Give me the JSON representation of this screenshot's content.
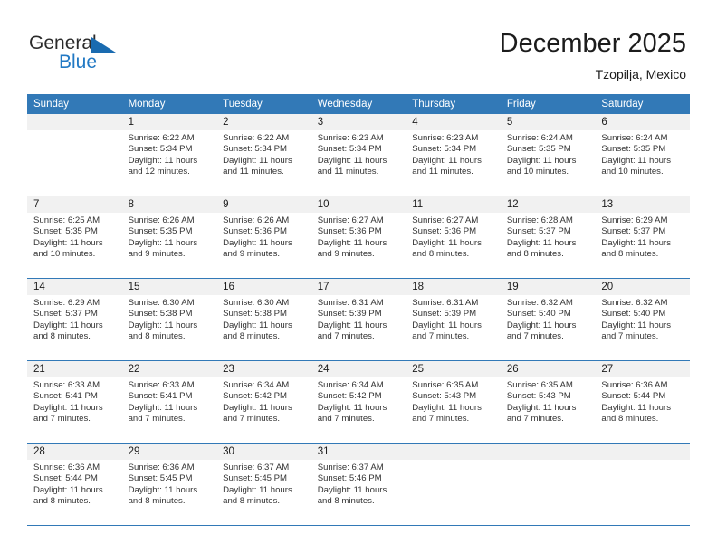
{
  "brand": {
    "name_part1": "General",
    "name_part2": "Blue",
    "triangle_icon": "triangle-icon",
    "accent_color": "#2279c4",
    "dark_color": "#2b2b2b"
  },
  "header": {
    "title": "December 2025",
    "subtitle": "Tzopilja, Mexico"
  },
  "theme": {
    "header_bg": "#3279b7",
    "daynum_bg": "#f1f1f1",
    "row_divider": "#3279b7"
  },
  "calendar": {
    "weekday_headers": [
      "Sunday",
      "Monday",
      "Tuesday",
      "Wednesday",
      "Thursday",
      "Friday",
      "Saturday"
    ],
    "weeks": [
      [
        {
          "day": "",
          "sunrise": "",
          "sunset": "",
          "daylight_line1": "",
          "daylight_line2": ""
        },
        {
          "day": "1",
          "sunrise": "Sunrise: 6:22 AM",
          "sunset": "Sunset: 5:34 PM",
          "daylight_line1": "Daylight: 11 hours",
          "daylight_line2": "and 12 minutes."
        },
        {
          "day": "2",
          "sunrise": "Sunrise: 6:22 AM",
          "sunset": "Sunset: 5:34 PM",
          "daylight_line1": "Daylight: 11 hours",
          "daylight_line2": "and 11 minutes."
        },
        {
          "day": "3",
          "sunrise": "Sunrise: 6:23 AM",
          "sunset": "Sunset: 5:34 PM",
          "daylight_line1": "Daylight: 11 hours",
          "daylight_line2": "and 11 minutes."
        },
        {
          "day": "4",
          "sunrise": "Sunrise: 6:23 AM",
          "sunset": "Sunset: 5:34 PM",
          "daylight_line1": "Daylight: 11 hours",
          "daylight_line2": "and 11 minutes."
        },
        {
          "day": "5",
          "sunrise": "Sunrise: 6:24 AM",
          "sunset": "Sunset: 5:35 PM",
          "daylight_line1": "Daylight: 11 hours",
          "daylight_line2": "and 10 minutes."
        },
        {
          "day": "6",
          "sunrise": "Sunrise: 6:24 AM",
          "sunset": "Sunset: 5:35 PM",
          "daylight_line1": "Daylight: 11 hours",
          "daylight_line2": "and 10 minutes."
        }
      ],
      [
        {
          "day": "7",
          "sunrise": "Sunrise: 6:25 AM",
          "sunset": "Sunset: 5:35 PM",
          "daylight_line1": "Daylight: 11 hours",
          "daylight_line2": "and 10 minutes."
        },
        {
          "day": "8",
          "sunrise": "Sunrise: 6:26 AM",
          "sunset": "Sunset: 5:35 PM",
          "daylight_line1": "Daylight: 11 hours",
          "daylight_line2": "and 9 minutes."
        },
        {
          "day": "9",
          "sunrise": "Sunrise: 6:26 AM",
          "sunset": "Sunset: 5:36 PM",
          "daylight_line1": "Daylight: 11 hours",
          "daylight_line2": "and 9 minutes."
        },
        {
          "day": "10",
          "sunrise": "Sunrise: 6:27 AM",
          "sunset": "Sunset: 5:36 PM",
          "daylight_line1": "Daylight: 11 hours",
          "daylight_line2": "and 9 minutes."
        },
        {
          "day": "11",
          "sunrise": "Sunrise: 6:27 AM",
          "sunset": "Sunset: 5:36 PM",
          "daylight_line1": "Daylight: 11 hours",
          "daylight_line2": "and 8 minutes."
        },
        {
          "day": "12",
          "sunrise": "Sunrise: 6:28 AM",
          "sunset": "Sunset: 5:37 PM",
          "daylight_line1": "Daylight: 11 hours",
          "daylight_line2": "and 8 minutes."
        },
        {
          "day": "13",
          "sunrise": "Sunrise: 6:29 AM",
          "sunset": "Sunset: 5:37 PM",
          "daylight_line1": "Daylight: 11 hours",
          "daylight_line2": "and 8 minutes."
        }
      ],
      [
        {
          "day": "14",
          "sunrise": "Sunrise: 6:29 AM",
          "sunset": "Sunset: 5:37 PM",
          "daylight_line1": "Daylight: 11 hours",
          "daylight_line2": "and 8 minutes."
        },
        {
          "day": "15",
          "sunrise": "Sunrise: 6:30 AM",
          "sunset": "Sunset: 5:38 PM",
          "daylight_line1": "Daylight: 11 hours",
          "daylight_line2": "and 8 minutes."
        },
        {
          "day": "16",
          "sunrise": "Sunrise: 6:30 AM",
          "sunset": "Sunset: 5:38 PM",
          "daylight_line1": "Daylight: 11 hours",
          "daylight_line2": "and 8 minutes."
        },
        {
          "day": "17",
          "sunrise": "Sunrise: 6:31 AM",
          "sunset": "Sunset: 5:39 PM",
          "daylight_line1": "Daylight: 11 hours",
          "daylight_line2": "and 7 minutes."
        },
        {
          "day": "18",
          "sunrise": "Sunrise: 6:31 AM",
          "sunset": "Sunset: 5:39 PM",
          "daylight_line1": "Daylight: 11 hours",
          "daylight_line2": "and 7 minutes."
        },
        {
          "day": "19",
          "sunrise": "Sunrise: 6:32 AM",
          "sunset": "Sunset: 5:40 PM",
          "daylight_line1": "Daylight: 11 hours",
          "daylight_line2": "and 7 minutes."
        },
        {
          "day": "20",
          "sunrise": "Sunrise: 6:32 AM",
          "sunset": "Sunset: 5:40 PM",
          "daylight_line1": "Daylight: 11 hours",
          "daylight_line2": "and 7 minutes."
        }
      ],
      [
        {
          "day": "21",
          "sunrise": "Sunrise: 6:33 AM",
          "sunset": "Sunset: 5:41 PM",
          "daylight_line1": "Daylight: 11 hours",
          "daylight_line2": "and 7 minutes."
        },
        {
          "day": "22",
          "sunrise": "Sunrise: 6:33 AM",
          "sunset": "Sunset: 5:41 PM",
          "daylight_line1": "Daylight: 11 hours",
          "daylight_line2": "and 7 minutes."
        },
        {
          "day": "23",
          "sunrise": "Sunrise: 6:34 AM",
          "sunset": "Sunset: 5:42 PM",
          "daylight_line1": "Daylight: 11 hours",
          "daylight_line2": "and 7 minutes."
        },
        {
          "day": "24",
          "sunrise": "Sunrise: 6:34 AM",
          "sunset": "Sunset: 5:42 PM",
          "daylight_line1": "Daylight: 11 hours",
          "daylight_line2": "and 7 minutes."
        },
        {
          "day": "25",
          "sunrise": "Sunrise: 6:35 AM",
          "sunset": "Sunset: 5:43 PM",
          "daylight_line1": "Daylight: 11 hours",
          "daylight_line2": "and 7 minutes."
        },
        {
          "day": "26",
          "sunrise": "Sunrise: 6:35 AM",
          "sunset": "Sunset: 5:43 PM",
          "daylight_line1": "Daylight: 11 hours",
          "daylight_line2": "and 7 minutes."
        },
        {
          "day": "27",
          "sunrise": "Sunrise: 6:36 AM",
          "sunset": "Sunset: 5:44 PM",
          "daylight_line1": "Daylight: 11 hours",
          "daylight_line2": "and 8 minutes."
        }
      ],
      [
        {
          "day": "28",
          "sunrise": "Sunrise: 6:36 AM",
          "sunset": "Sunset: 5:44 PM",
          "daylight_line1": "Daylight: 11 hours",
          "daylight_line2": "and 8 minutes."
        },
        {
          "day": "29",
          "sunrise": "Sunrise: 6:36 AM",
          "sunset": "Sunset: 5:45 PM",
          "daylight_line1": "Daylight: 11 hours",
          "daylight_line2": "and 8 minutes."
        },
        {
          "day": "30",
          "sunrise": "Sunrise: 6:37 AM",
          "sunset": "Sunset: 5:45 PM",
          "daylight_line1": "Daylight: 11 hours",
          "daylight_line2": "and 8 minutes."
        },
        {
          "day": "31",
          "sunrise": "Sunrise: 6:37 AM",
          "sunset": "Sunset: 5:46 PM",
          "daylight_line1": "Daylight: 11 hours",
          "daylight_line2": "and 8 minutes."
        },
        {
          "day": "",
          "sunrise": "",
          "sunset": "",
          "daylight_line1": "",
          "daylight_line2": ""
        },
        {
          "day": "",
          "sunrise": "",
          "sunset": "",
          "daylight_line1": "",
          "daylight_line2": ""
        },
        {
          "day": "",
          "sunrise": "",
          "sunset": "",
          "daylight_line1": "",
          "daylight_line2": ""
        }
      ]
    ]
  }
}
